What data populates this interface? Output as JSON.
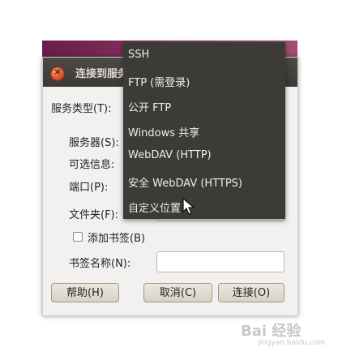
{
  "dialog": {
    "title": "连接到服务器",
    "labels": {
      "service_type": "服务类型(T):",
      "server": "服务器(S):",
      "optional_info": "可选信息:",
      "port": "端口(P):",
      "folder": "文件夹(F):",
      "add_bookmark": "添加书签(B)",
      "bookmark_name": "书签名称(N):"
    },
    "buttons": {
      "help": "帮助(H)",
      "cancel": "取消(C)",
      "connect": "连接(O)"
    }
  },
  "menu": {
    "items": [
      "SSH",
      "FTP (需登录)",
      "公开 FTP",
      "Windows 共享",
      "WebDAV (HTTP)",
      "安全 WebDAV (HTTPS)",
      "自定义位置"
    ]
  },
  "watermark": {
    "text": "Bai 经验",
    "url": "jingyan.baidu.com"
  }
}
